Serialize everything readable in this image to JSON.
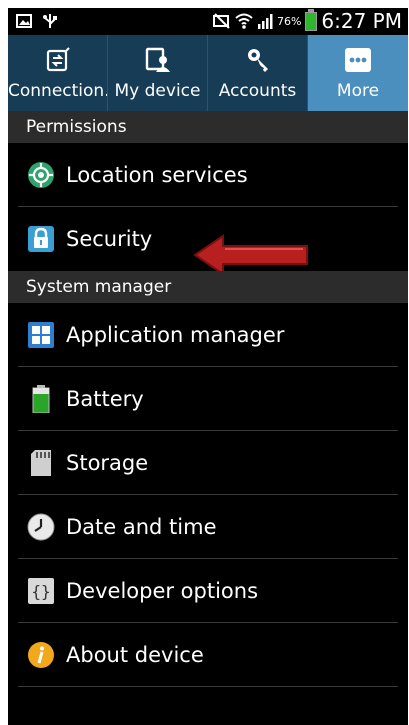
{
  "status_bar": {
    "battery_percent": "76%",
    "time": "6:27 PM",
    "left_icons": [
      "screenshot-icon",
      "usb-icon"
    ],
    "right_icons": [
      "mute-icon",
      "wifi-icon",
      "signal-icon",
      "battery-icon"
    ]
  },
  "tabs": [
    {
      "label": "Connection..",
      "icon": "connections-icon",
      "active": false
    },
    {
      "label": "My device",
      "icon": "my-device-icon",
      "active": false
    },
    {
      "label": "Accounts",
      "icon": "accounts-icon",
      "active": false
    },
    {
      "label": "More",
      "icon": "more-icon",
      "active": true
    }
  ],
  "sections": [
    {
      "header": "Permissions",
      "items": [
        {
          "label": "Location services",
          "icon": "location-icon"
        },
        {
          "label": "Security",
          "icon": "lock-icon"
        }
      ]
    },
    {
      "header": "System manager",
      "items": [
        {
          "label": "Application manager",
          "icon": "app-grid-icon"
        },
        {
          "label": "Battery",
          "icon": "battery-icon"
        },
        {
          "label": "Storage",
          "icon": "sd-card-icon"
        },
        {
          "label": "Date and time",
          "icon": "clock-icon"
        },
        {
          "label": "Developer options",
          "icon": "braces-icon"
        },
        {
          "label": "About device",
          "icon": "info-icon"
        }
      ]
    }
  ],
  "colors": {
    "tab_bg": "#173c55",
    "tab_active": "#4a8fbd",
    "section_header_bg": "#2c2c2c",
    "annotation_arrow": "#b81f1f"
  }
}
